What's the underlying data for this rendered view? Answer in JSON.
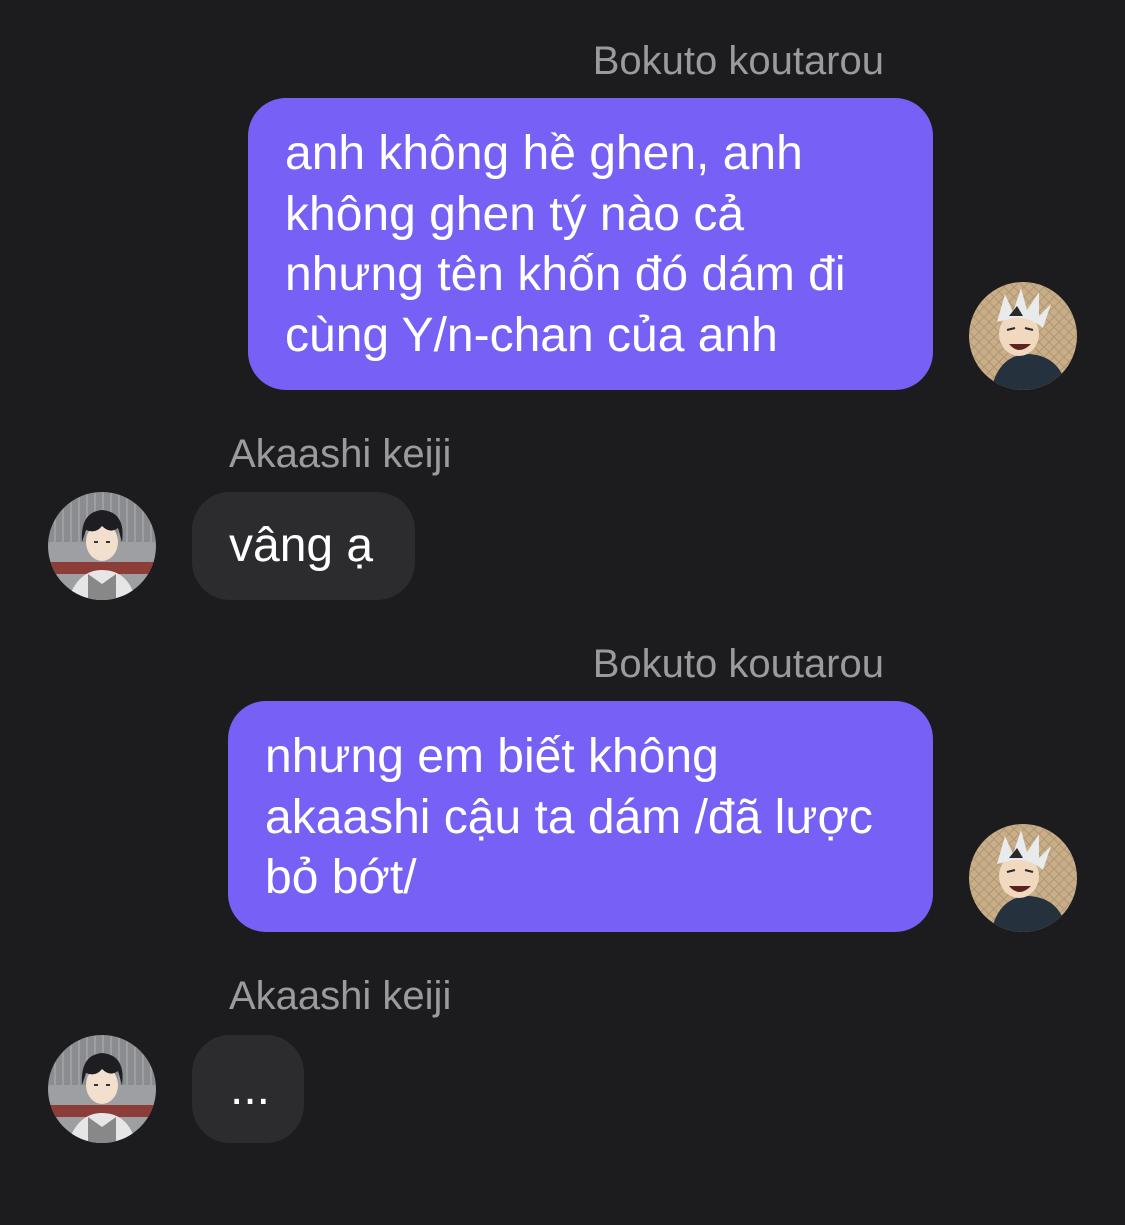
{
  "messages": [
    {
      "sender": "Bokuto koutarou",
      "direction": "outgoing",
      "avatar": "bokuto-avatar",
      "text": "anh không hề ghen, anh\nkhông ghen tý nào cả\nnhưng tên khốn đó dám đi\ncùng Y/n-chan của anh"
    },
    {
      "sender": "Akaashi keiji",
      "direction": "incoming",
      "avatar": "akaashi-avatar",
      "text": "vâng ạ"
    },
    {
      "sender": "Bokuto koutarou",
      "direction": "outgoing",
      "avatar": "bokuto-avatar",
      "text": "nhưng em biết không\nakaashi cậu ta dám /đã lược\nbỏ bớt/"
    },
    {
      "sender": "Akaashi keiji",
      "direction": "incoming",
      "avatar": "akaashi-avatar",
      "text": "..."
    }
  ],
  "colors": {
    "background": "#1c1c1e",
    "outgoing_bubble": "#7660f5",
    "incoming_bubble": "#2c2c2e",
    "sender_name": "#9a9a9f",
    "message_text": "#ffffff"
  }
}
